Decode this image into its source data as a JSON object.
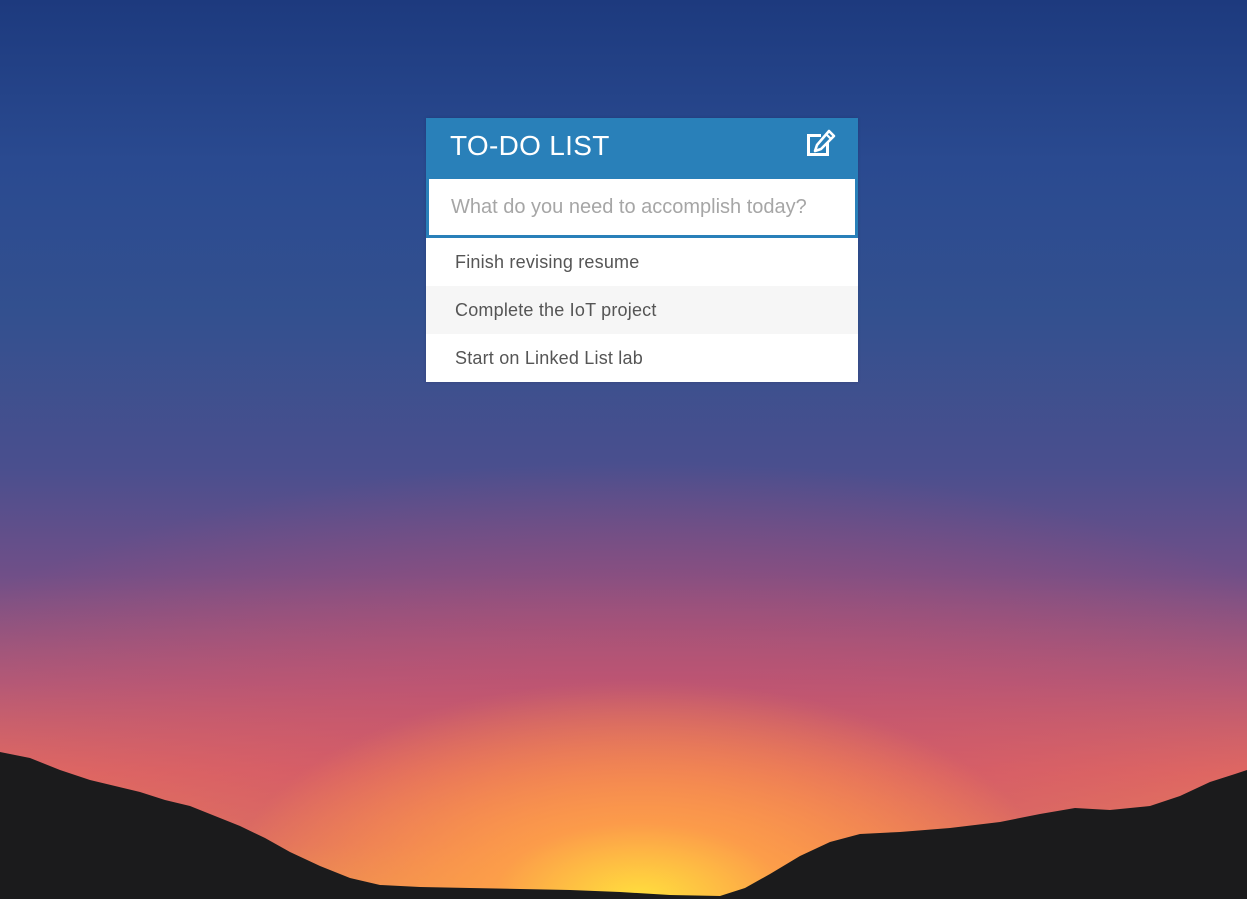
{
  "header": {
    "title": "TO-DO LIST",
    "toggle_icon": "edit-icon"
  },
  "input": {
    "placeholder": "What do you need to accomplish today?",
    "value": ""
  },
  "todos": [
    {
      "text": "Finish revising resume"
    },
    {
      "text": "Complete the IoT project"
    },
    {
      "text": "Start on Linked List lab"
    }
  ],
  "colors": {
    "accent": "#2980b9",
    "item_text": "#555555",
    "item_alt_bg": "#f6f6f6"
  }
}
